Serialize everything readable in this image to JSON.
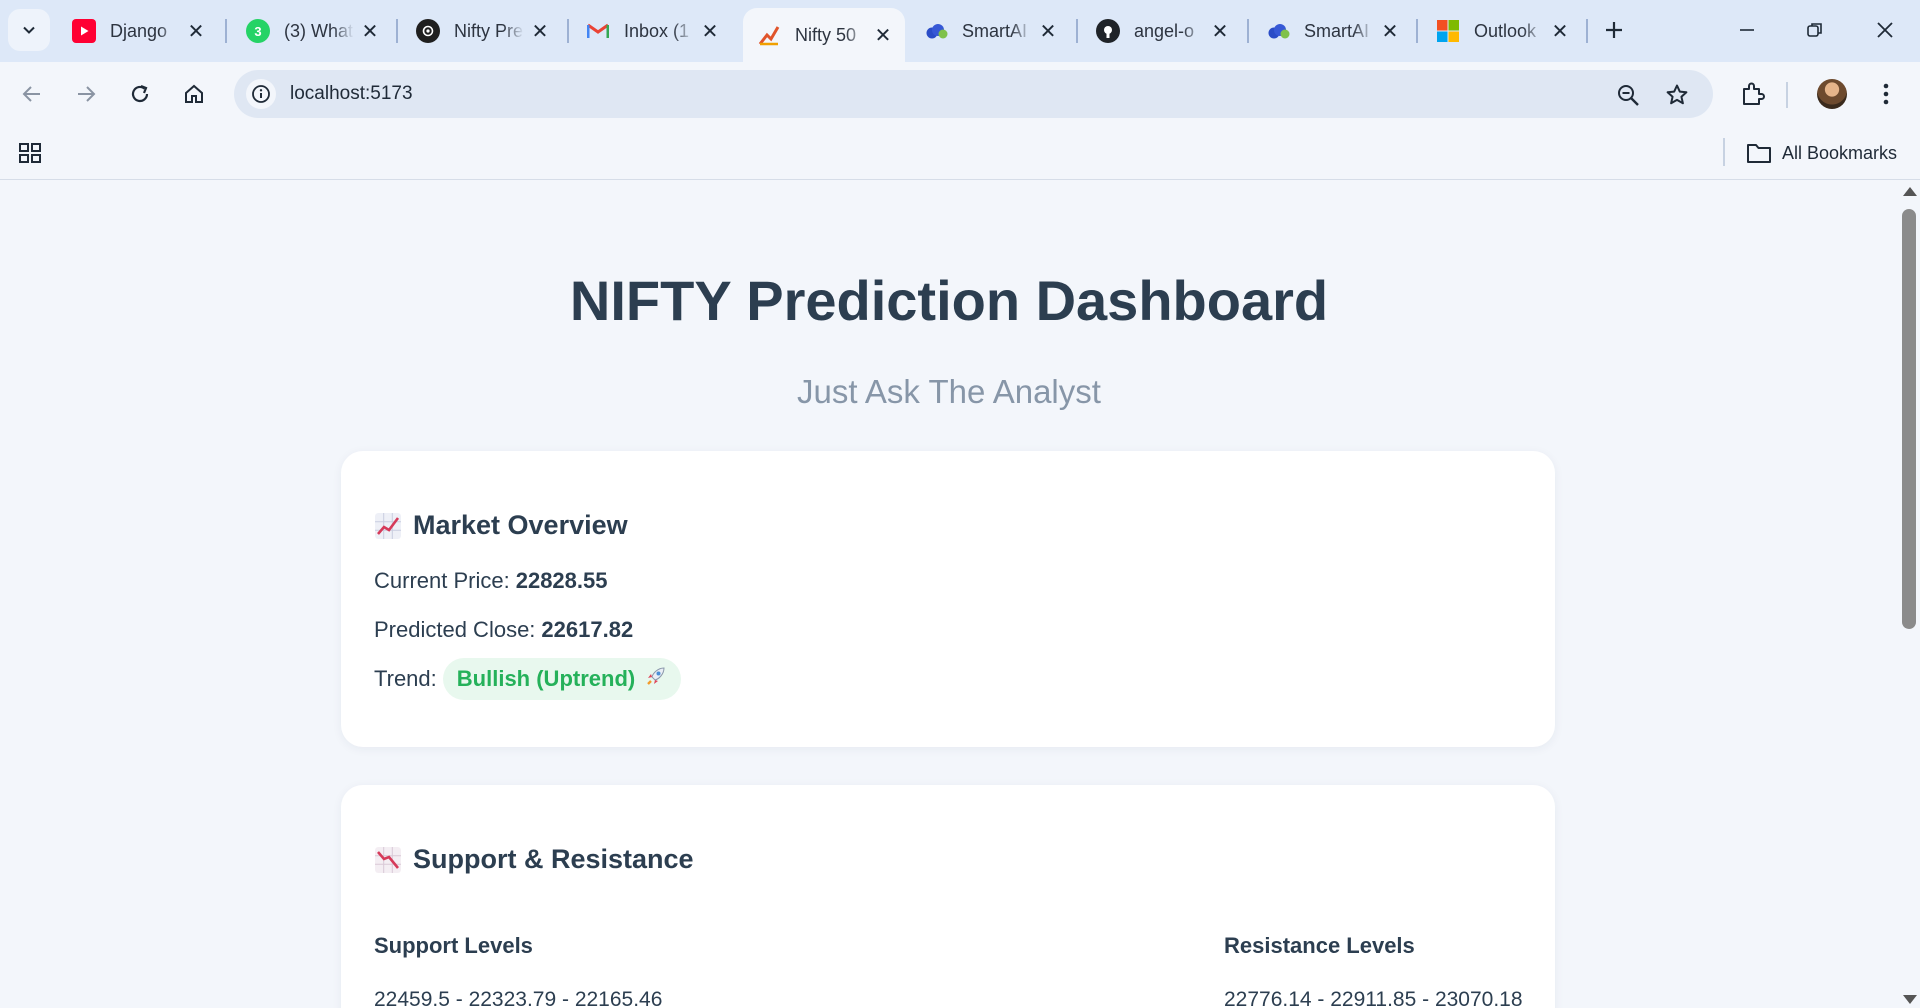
{
  "browser": {
    "tabs": [
      {
        "title": "Django",
        "icon": "youtube-icon"
      },
      {
        "title": "(3) What",
        "icon": "whatsapp-icon",
        "badge": "3"
      },
      {
        "title": "Nifty Pre",
        "icon": "openai-icon"
      },
      {
        "title": "Inbox (1",
        "icon": "gmail-icon"
      },
      {
        "title": "Nifty 50",
        "icon": "nifty-chart-icon",
        "active": true
      },
      {
        "title": "SmartAI",
        "icon": "cloud-icon"
      },
      {
        "title": "angel-o",
        "icon": "github-icon"
      },
      {
        "title": "SmartAI",
        "icon": "cloud-icon"
      },
      {
        "title": "Outlook",
        "icon": "microsoft-icon"
      }
    ],
    "url": "localhost:5173",
    "bookmarks_label": "All Bookmarks"
  },
  "page": {
    "title": "NIFTY Prediction Dashboard",
    "subtitle": "Just Ask The Analyst",
    "market_overview": {
      "heading": "Market Overview",
      "current_price_label": "Current Price:",
      "current_price": "22828.55",
      "predicted_close_label": "Predicted Close:",
      "predicted_close": "22617.82",
      "trend_label": "Trend:",
      "trend_value": "Bullish (Uptrend)",
      "trend_icon": "rocket-icon"
    },
    "support_resistance": {
      "heading": "Support & Resistance",
      "support_heading": "Support Levels",
      "support_values": "22459.5 - 22323.79 - 22165.46",
      "resistance_heading": "Resistance Levels",
      "resistance_values": "22776.14 - 22911.85 - 23070.18"
    }
  },
  "colors": {
    "title": "#2c3e50",
    "subtitle": "#8796a8",
    "trend_bullish": "#25b15a",
    "trend_badge_bg": "#e8f8ee",
    "tabstrip_bg": "#dde8f8"
  }
}
